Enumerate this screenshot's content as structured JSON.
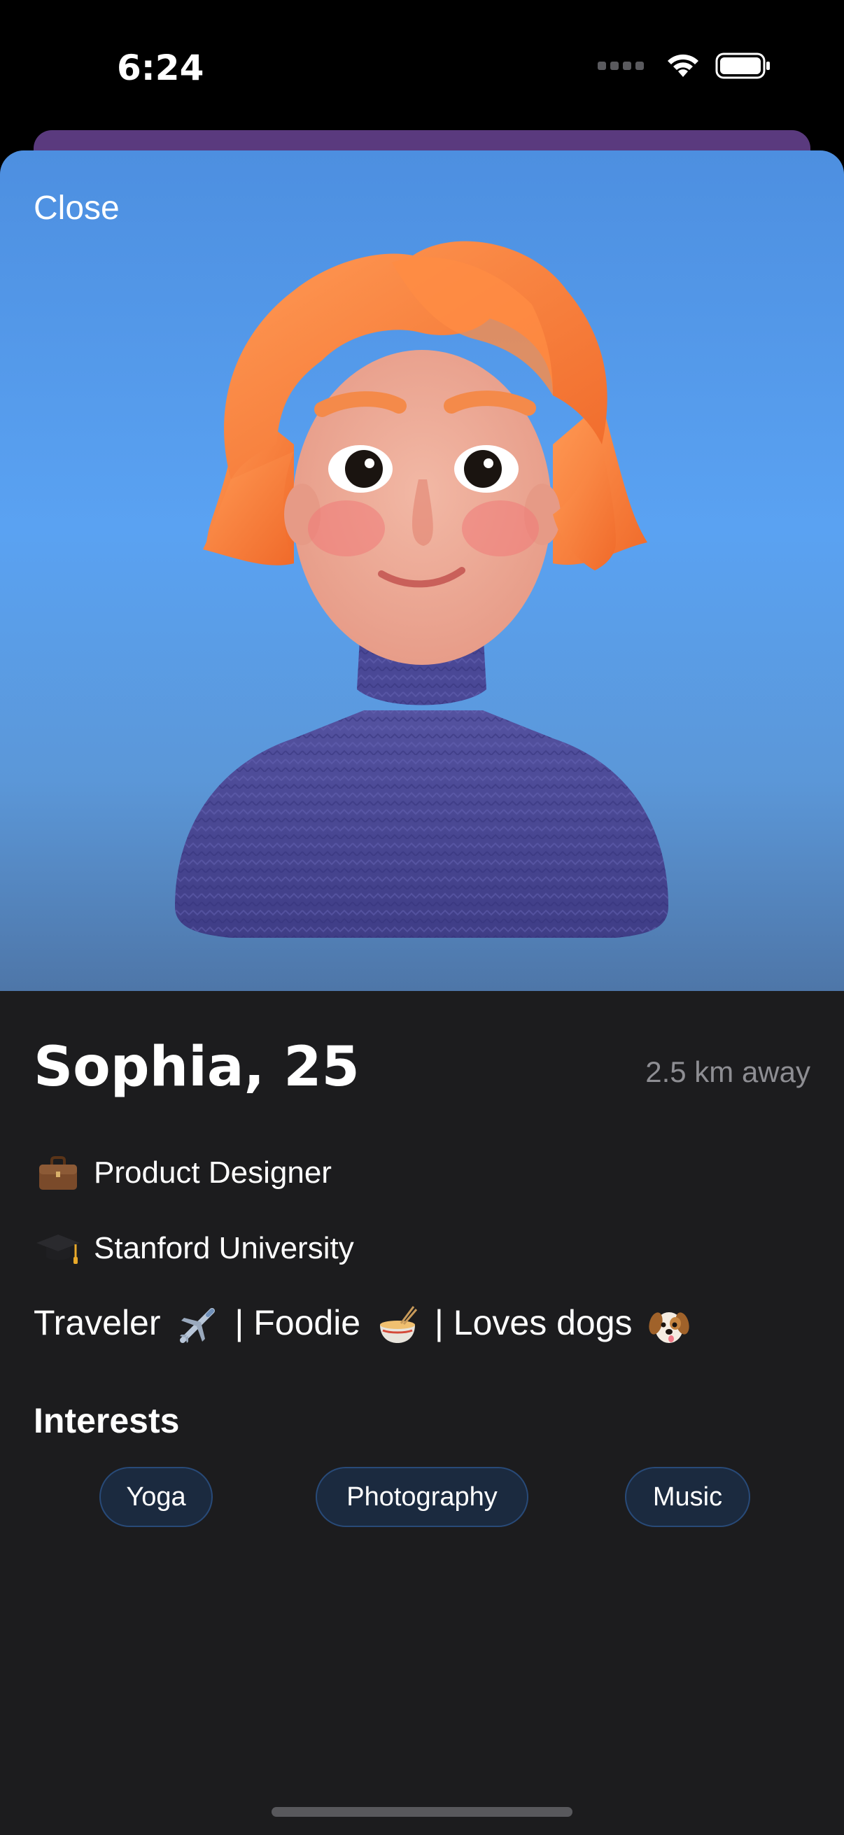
{
  "status_bar": {
    "time": "6:24"
  },
  "profile": {
    "close_label": "Close",
    "name_age": "Sophia, 25",
    "distance": "2.5 km away",
    "job": "Product Designer",
    "job_icon": "briefcase-icon",
    "school": "Stanford University",
    "school_icon": "graduation-cap-icon",
    "bio": {
      "part1": "Traveler",
      "part2": " | Foodie",
      "part3": " | Loves dogs",
      "icons": [
        "airplane-emoji",
        "noodle-bowl-emoji",
        "dog-face-emoji"
      ]
    },
    "interests_title": "Interests",
    "interests": [
      "Yoga",
      "Photography",
      "Music"
    ]
  },
  "colors": {
    "hero_top": "#4d8fe0",
    "hero_bottom": "#4e76a8",
    "sheet_bg": "#1c1c1e",
    "back_sheet": "#5a3a7e",
    "chip_bg": "#1b2a3f",
    "chip_border": "#284a78",
    "secondary_text": "#8e8e93"
  }
}
